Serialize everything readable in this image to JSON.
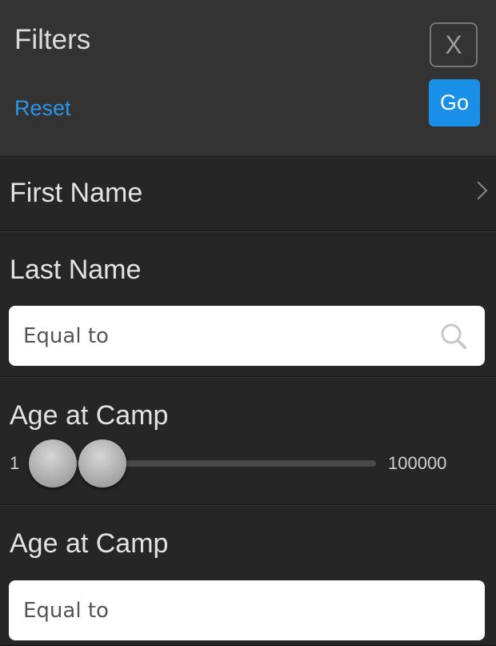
{
  "header": {
    "title": "Filters",
    "reset_label": "Reset",
    "close_label": "X",
    "go_label": "Go"
  },
  "filters": {
    "first_name": {
      "label": "First Name"
    },
    "last_name": {
      "label": "Last Name",
      "placeholder": "Equal to",
      "icon": "search-icon"
    },
    "age_slider": {
      "label": "Age at Camp",
      "min_label": "1",
      "max_label": "100000",
      "range_min": 1,
      "range_max": 100000,
      "low_value": 1,
      "high_value": 1
    },
    "age_input": {
      "label": "Age at Camp",
      "placeholder": "Equal to"
    }
  },
  "colors": {
    "accent": "#1a8fe8",
    "link": "#2b96e8",
    "background": "#232323",
    "header_bg": "#333333"
  }
}
